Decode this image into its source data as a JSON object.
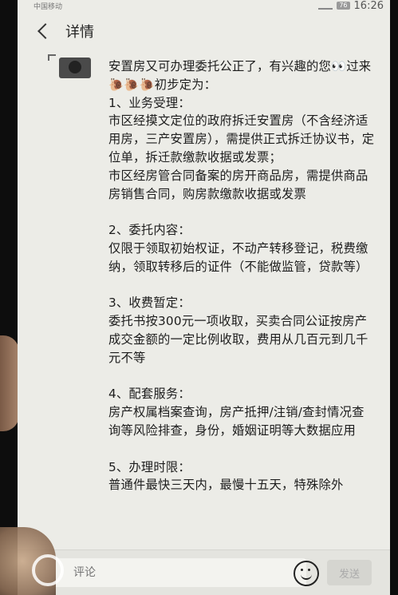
{
  "statusbar": {
    "carrier": "中国移动",
    "battery": "76",
    "time": "16:26"
  },
  "header": {
    "title": "详情"
  },
  "post": {
    "text": "安置房又可办理委托公正了，有兴趣的您👀过来🐌🐌🐌初步定为：\n1、业务受理：\n市区经摸文定位的政府拆迁安置房（不含经济适用房，三产安置房），需提供正式拆迁协议书，定位单，拆迁款缴款收据或发票；\n市区经房管合同备案的房开商品房，需提供商品房销售合同，购房款缴款收据或发票\n\n2、委托内容：\n仅限于领取初始权证，不动产转移登记，税费缴纳，领取转移后的证件（不能做监管，贷款等）\n\n3、收费暂定：\n委托书按300元一项收取，买卖合同公证按房产成交金额的一定比例收取，费用从几百元到几千元不等\n\n4、配套服务：\n房产权属档案查询，房产抵押/注销/查封情况查询等风险排查，身份，婚姻证明等大数据应用\n\n5、办理时限：\n普通件最快三天内，最慢十五天，特殊除外"
  },
  "comment": {
    "placeholder": "评论",
    "send_label": "发送"
  }
}
